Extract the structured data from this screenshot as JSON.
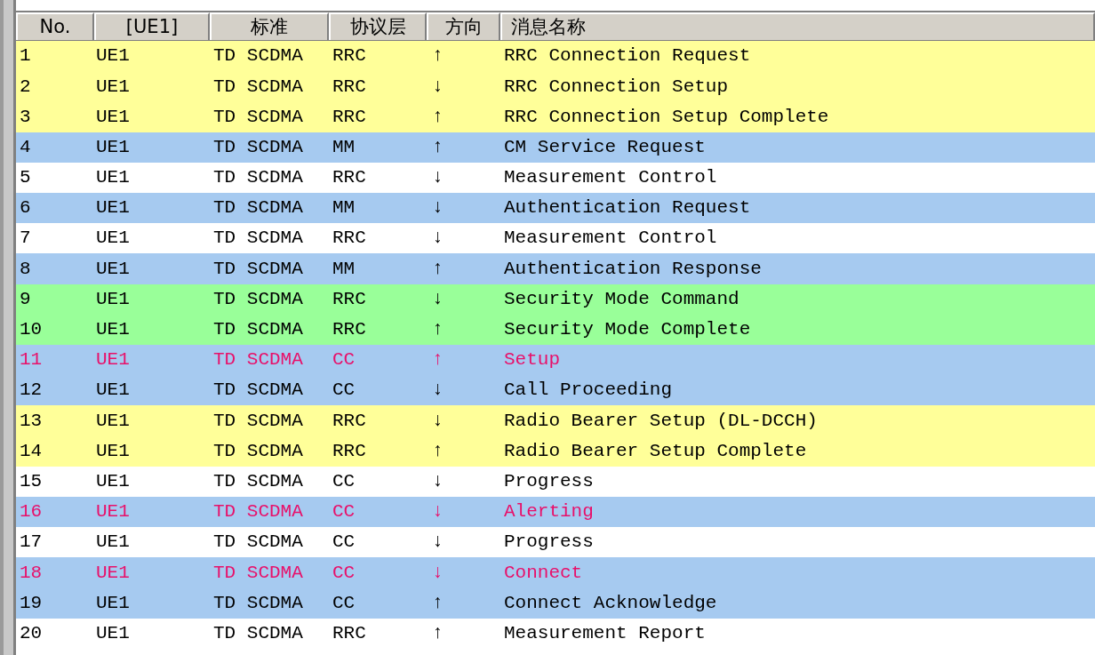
{
  "columns": [
    "No.",
    "[UE1]",
    "标准",
    "协议层",
    "方向",
    "消息名称"
  ],
  "rows": [
    {
      "no": "1",
      "ue": "UE1",
      "standard": "TD SCDMA",
      "layer": "RRC",
      "direction": "↑",
      "message": "RRC Connection Request",
      "color": "#ffff99",
      "alert": false
    },
    {
      "no": "2",
      "ue": "UE1",
      "standard": "TD SCDMA",
      "layer": "RRC",
      "direction": "↓",
      "message": "RRC Connection Setup",
      "color": "#ffff99",
      "alert": false
    },
    {
      "no": "3",
      "ue": "UE1",
      "standard": "TD SCDMA",
      "layer": "RRC",
      "direction": "↑",
      "message": "RRC Connection Setup Complete",
      "color": "#ffff99",
      "alert": false
    },
    {
      "no": "4",
      "ue": "UE1",
      "standard": "TD SCDMA",
      "layer": "MM",
      "direction": "↑",
      "message": "CM Service Request",
      "color": "#a6caf0",
      "alert": false
    },
    {
      "no": "5",
      "ue": "UE1",
      "standard": "TD SCDMA",
      "layer": "RRC",
      "direction": "↓",
      "message": "Measurement Control",
      "color": "#ffffff",
      "alert": false
    },
    {
      "no": "6",
      "ue": "UE1",
      "standard": "TD SCDMA",
      "layer": "MM",
      "direction": "↓",
      "message": "Authentication Request",
      "color": "#a6caf0",
      "alert": false
    },
    {
      "no": "7",
      "ue": "UE1",
      "standard": "TD SCDMA",
      "layer": "RRC",
      "direction": "↓",
      "message": "Measurement Control",
      "color": "#ffffff",
      "alert": false
    },
    {
      "no": "8",
      "ue": "UE1",
      "standard": "TD SCDMA",
      "layer": "MM",
      "direction": "↑",
      "message": "Authentication Response",
      "color": "#a6caf0",
      "alert": false
    },
    {
      "no": "9",
      "ue": "UE1",
      "standard": "TD SCDMA",
      "layer": "RRC",
      "direction": "↓",
      "message": "Security Mode Command",
      "color": "#99ff99",
      "alert": false
    },
    {
      "no": "10",
      "ue": "UE1",
      "standard": "TD SCDMA",
      "layer": "RRC",
      "direction": "↑",
      "message": "Security Mode Complete",
      "color": "#99ff99",
      "alert": false
    },
    {
      "no": "11",
      "ue": "UE1",
      "standard": "TD SCDMA",
      "layer": "CC",
      "direction": "↑",
      "message": "Setup",
      "color": "#a6caf0",
      "alert": true
    },
    {
      "no": "12",
      "ue": "UE1",
      "standard": "TD SCDMA",
      "layer": "CC",
      "direction": "↓",
      "message": "Call Proceeding",
      "color": "#a6caf0",
      "alert": false
    },
    {
      "no": "13",
      "ue": "UE1",
      "standard": "TD SCDMA",
      "layer": "RRC",
      "direction": "↓",
      "message": "Radio Bearer Setup (DL-DCCH)",
      "color": "#ffff99",
      "alert": false
    },
    {
      "no": "14",
      "ue": "UE1",
      "standard": "TD SCDMA",
      "layer": "RRC",
      "direction": "↑",
      "message": "Radio Bearer Setup Complete",
      "color": "#ffff99",
      "alert": false
    },
    {
      "no": "15",
      "ue": "UE1",
      "standard": "TD SCDMA",
      "layer": "CC",
      "direction": "↓",
      "message": "Progress",
      "color": "#ffffff",
      "alert": false
    },
    {
      "no": "16",
      "ue": "UE1",
      "standard": "TD SCDMA",
      "layer": "CC",
      "direction": "↓",
      "message": "Alerting",
      "color": "#a6caf0",
      "alert": true
    },
    {
      "no": "17",
      "ue": "UE1",
      "standard": "TD SCDMA",
      "layer": "CC",
      "direction": "↓",
      "message": "Progress",
      "color": "#ffffff",
      "alert": false
    },
    {
      "no": "18",
      "ue": "UE1",
      "standard": "TD SCDMA",
      "layer": "CC",
      "direction": "↓",
      "message": "Connect",
      "color": "#a6caf0",
      "alert": true
    },
    {
      "no": "19",
      "ue": "UE1",
      "standard": "TD SCDMA",
      "layer": "CC",
      "direction": "↑",
      "message": "Connect Acknowledge",
      "color": "#a6caf0",
      "alert": false
    },
    {
      "no": "20",
      "ue": "UE1",
      "standard": "TD SCDMA",
      "layer": "RRC",
      "direction": "↑",
      "message": "Measurement Report",
      "color": "#ffffff",
      "alert": false
    }
  ]
}
